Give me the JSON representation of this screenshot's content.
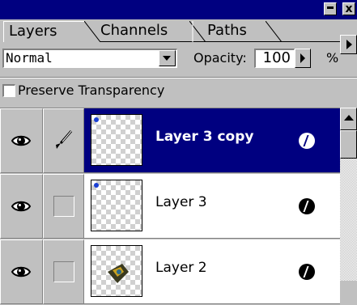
{
  "window": {
    "minimize_icon": "minimize-icon",
    "close_label": "x"
  },
  "tabs": [
    {
      "label": "Layers",
      "active": true
    },
    {
      "label": "Channels",
      "active": false
    },
    {
      "label": "Paths",
      "active": false
    }
  ],
  "blend": {
    "mode": "Normal",
    "opacity_label": "Opacity:",
    "opacity_value": "100",
    "percent_sign": "%"
  },
  "preserve": {
    "label": "Preserve Transparency",
    "checked": false
  },
  "layers": [
    {
      "name": "Layer 3 copy",
      "selected": true,
      "visible": true,
      "paint_active": true
    },
    {
      "name": "Layer 3",
      "selected": false,
      "visible": true,
      "paint_active": false
    },
    {
      "name": "Layer 2",
      "selected": false,
      "visible": true,
      "paint_active": false
    }
  ],
  "colors": {
    "title_bar": "#000080",
    "selection": "#000080",
    "face": "#c0c0c0"
  }
}
